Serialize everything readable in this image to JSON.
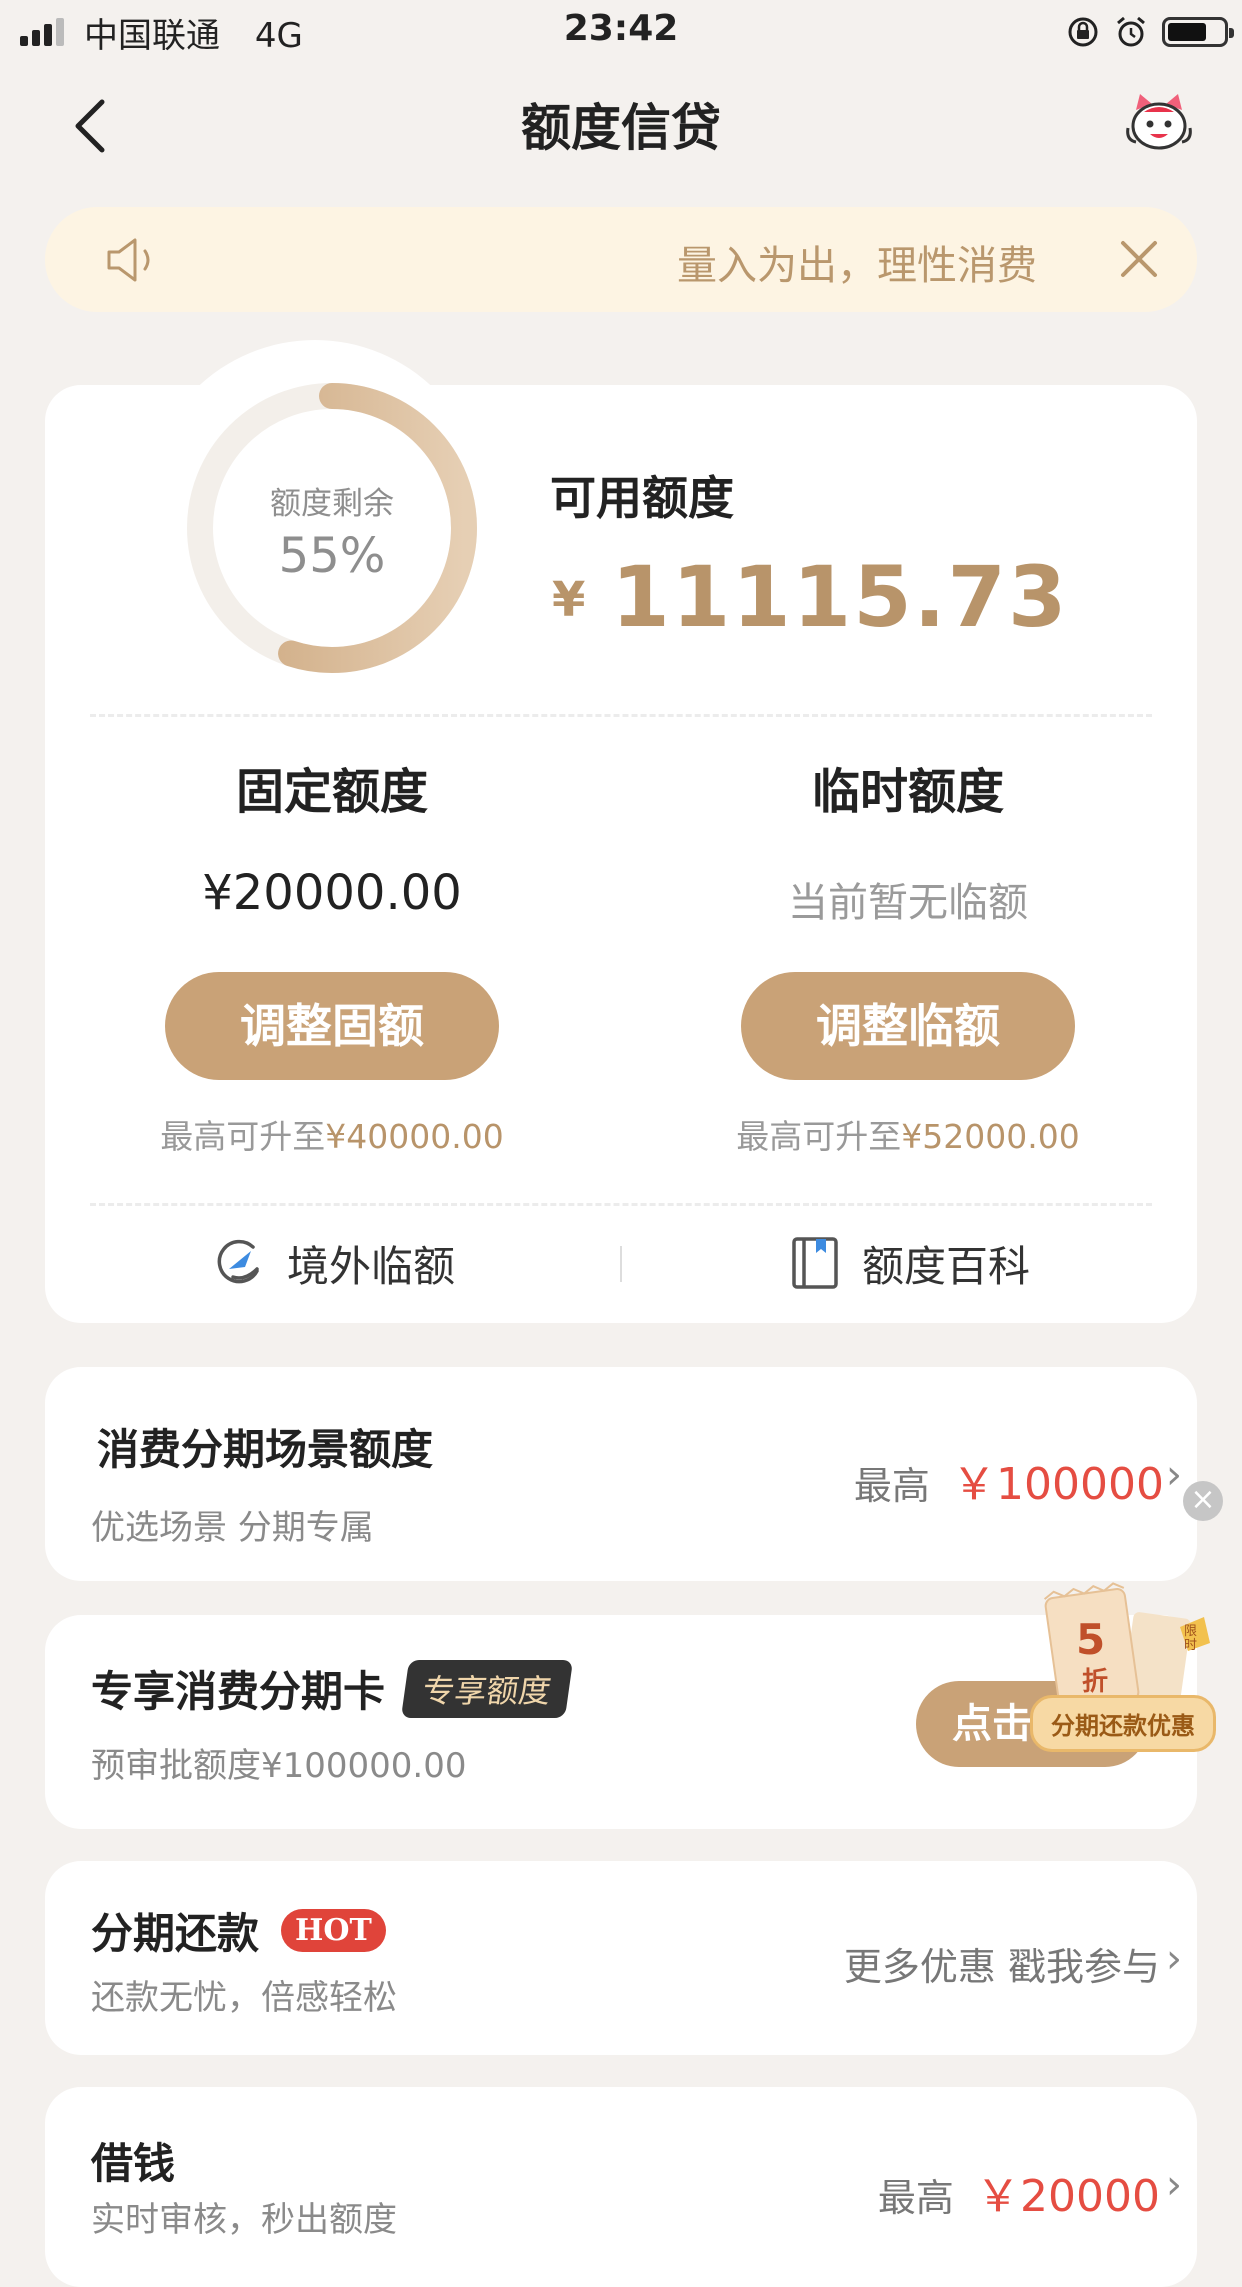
{
  "status_bar": {
    "carrier": "中国联通",
    "network": "4G",
    "time": "23:42"
  },
  "nav": {
    "title": "额度信贷"
  },
  "notice": {
    "text": "量入为出，理性消费"
  },
  "credit": {
    "ring_label": "额度剩余",
    "ring_percent": "55%",
    "ring_fraction": 0.55,
    "available_label": "可用额度",
    "currency": "¥",
    "available_amount": "11115.73",
    "fixed": {
      "title": "固定额度",
      "value": "¥20000.00",
      "button": "调整固额",
      "hint_prefix": "最高可升至",
      "hint_amount": "¥40000.00"
    },
    "temporary": {
      "title": "临时额度",
      "value": "当前暂无临额",
      "button": "调整临额",
      "hint_prefix": "最高可升至",
      "hint_amount": "¥52000.00"
    },
    "links": {
      "overseas": "境外临额",
      "encyclopedia": "额度百科"
    }
  },
  "items": {
    "installment_scene": {
      "title": "消费分期场景额度",
      "subtitle": "优选场景 分期专属",
      "right_prefix": "最高",
      "right_amount": "￥100000"
    },
    "exclusive_card": {
      "title": "专享消费分期卡",
      "badge": "专享额度",
      "subtitle": "预审批额度¥100000.00",
      "button": "点击",
      "promo_digit": "5",
      "promo_zhe": "折",
      "promo_tag": "限时",
      "promo_label": "分期还款优惠"
    },
    "installment_repay": {
      "title": "分期还款",
      "badge": "HOT",
      "subtitle": "还款无忧，倍感轻松",
      "right_text": "更多优惠 戳我参与"
    },
    "borrow": {
      "title": "借钱",
      "subtitle": "实时审核，秒出额度",
      "right_prefix": "最高",
      "right_amount": "￥20000"
    }
  },
  "colors": {
    "gold": "#b8946a",
    "button_gold": "#c9a277",
    "red": "#e54d42",
    "background": "#f4f1ee"
  }
}
